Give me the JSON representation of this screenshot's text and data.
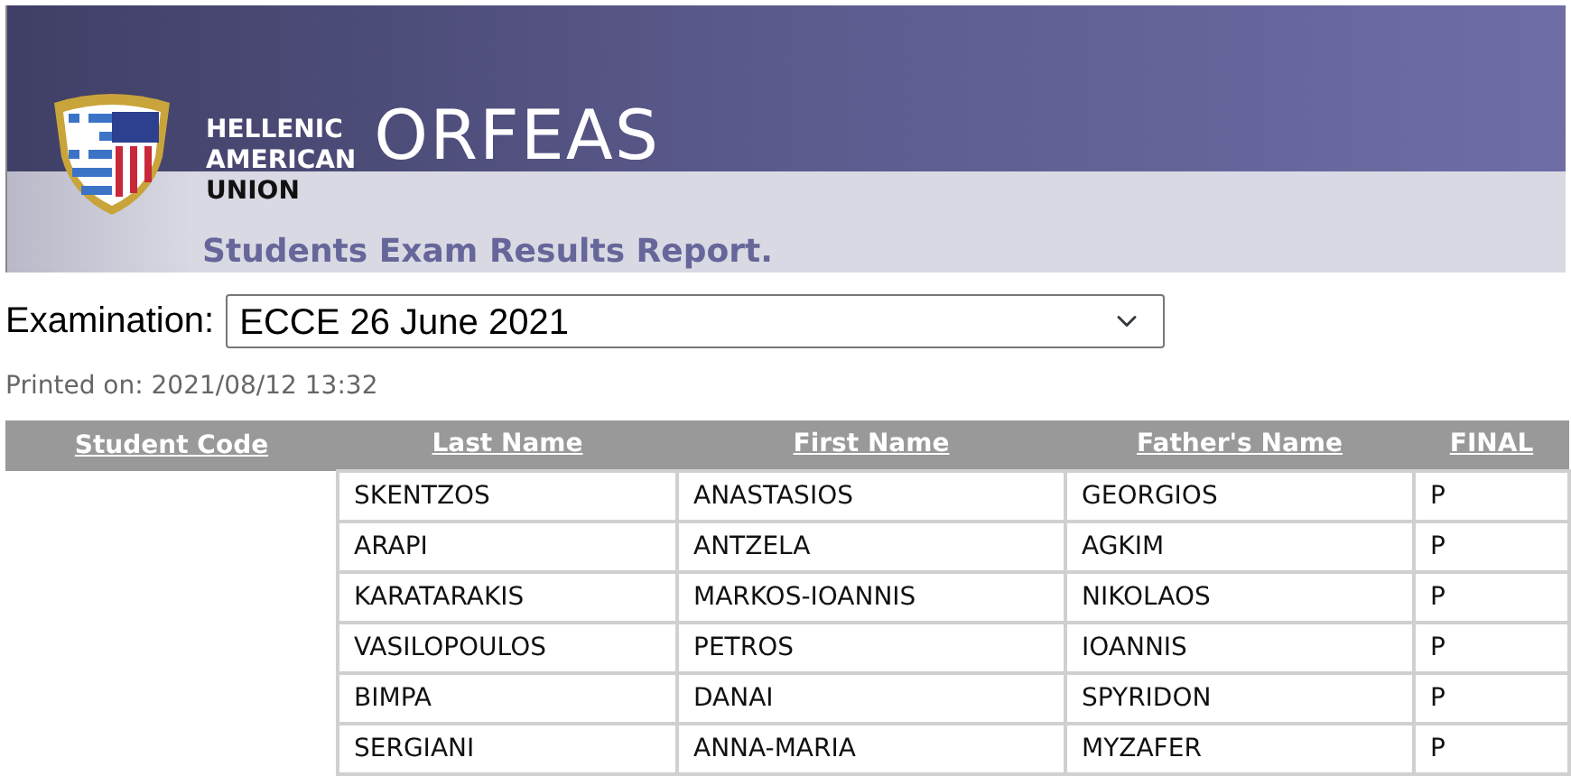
{
  "header": {
    "org_lines": [
      "HELLENIC",
      "AMERICAN",
      "UNION"
    ],
    "product": "ORFEAS",
    "report_title": "Students Exam Results Report."
  },
  "examination": {
    "label": "Examination:",
    "value": "ECCE 26 June 2021"
  },
  "printed_on": "Printed on: 2021/08/12 13:32",
  "table": {
    "columns": [
      "Student Code",
      "Last Name",
      "First Name",
      "Father's Name",
      "FINAL"
    ],
    "rows": [
      {
        "last_name": "SKENTZOS",
        "first_name": "ANASTASIOS",
        "fathers_name": "GEORGIOS",
        "final": "P"
      },
      {
        "last_name": "ARAPI",
        "first_name": "ANTZELA",
        "fathers_name": "AGKIM",
        "final": "P"
      },
      {
        "last_name": "KARATARAKIS",
        "first_name": "MARKOS-IOANNIS",
        "fathers_name": "NIKOLAOS",
        "final": "P"
      },
      {
        "last_name": "VASILOPOULOS",
        "first_name": "PETROS",
        "fathers_name": "IOANNIS",
        "final": "P"
      },
      {
        "last_name": "BIMPA",
        "first_name": "DANAI",
        "fathers_name": "SPYRIDON",
        "final": "P"
      },
      {
        "last_name": "SERGIANI",
        "first_name": "ANNA-MARIA",
        "fathers_name": "MYZAFER",
        "final": "P"
      }
    ]
  }
}
